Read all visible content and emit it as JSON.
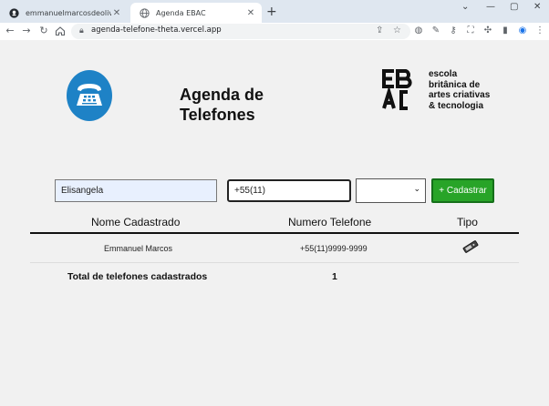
{
  "browser": {
    "tabs": [
      {
        "title": "emmanuelmarcosdeoliveira/agen",
        "active": false
      },
      {
        "title": "Agenda EBAC",
        "active": true
      }
    ],
    "address": "agenda-telefone-theta.vercel.app"
  },
  "header": {
    "title_line1": "Agenda de",
    "title_line2": "Telefones",
    "brand": {
      "line1": "escola",
      "line2": "britânica de",
      "line3": "artes criativas",
      "line4": "& tecnologia"
    }
  },
  "form": {
    "name_value": "Elisangela",
    "phone_value": "+55(11)",
    "type_value": "",
    "submit_label": "+ Cadastrar"
  },
  "table": {
    "headers": [
      "Nome Cadastrado",
      "Numero Telefone",
      "Tipo"
    ],
    "rows": [
      {
        "name": "Emmanuel Marcos",
        "phone": "+55(11)9999-9999",
        "type_icon": "mobile-phone-icon"
      }
    ]
  },
  "summary": {
    "label": "Total de telefones cadastrados",
    "count": "1"
  },
  "colors": {
    "accent_blue": "#1e82c6",
    "submit_green": "#28a428",
    "name_field_bg": "#e8f0fe"
  }
}
